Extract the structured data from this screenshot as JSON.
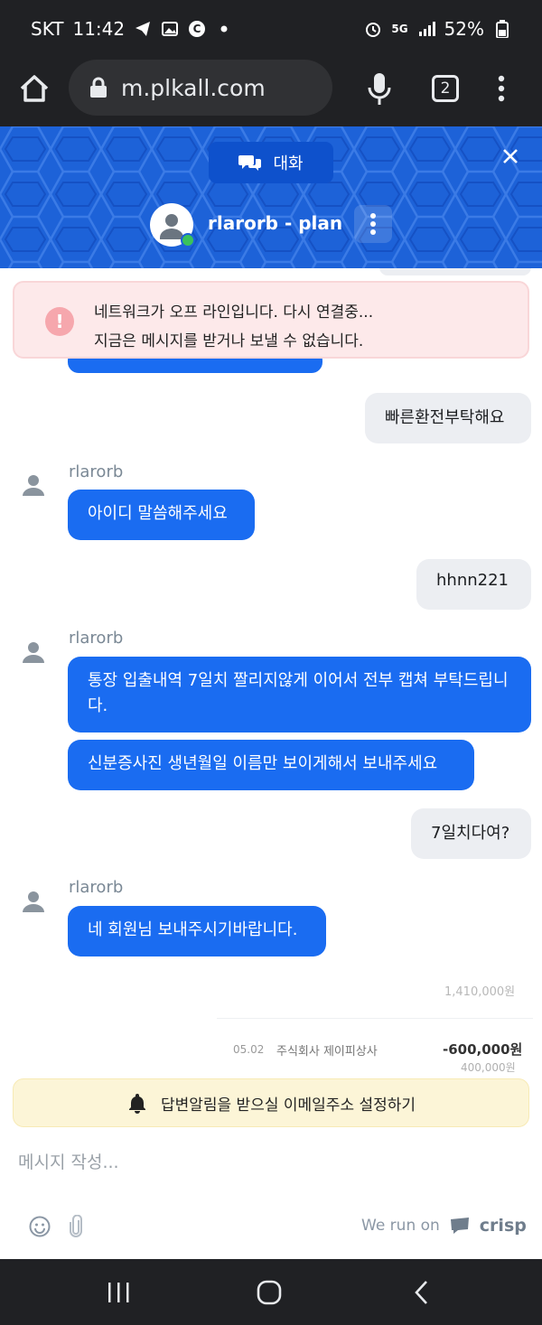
{
  "status_bar": {
    "carrier": "SKT",
    "time": "11:42",
    "network": "5G",
    "battery": "52%"
  },
  "browser": {
    "url": "m.plkall.com",
    "tab_count": "2"
  },
  "chat_header": {
    "conversation_label": "대화",
    "agent_name": "rlarorb - plan",
    "brand_color": "#1d62d8"
  },
  "offline_banner": {
    "line1": "네트워크가 오프 라인입니다. 다시 연결중...",
    "line2": "지금은 메시지를 받거나 보낼 수 없습니다."
  },
  "messages": [
    {
      "from": "user",
      "text": "빠른환전부탁해요"
    },
    {
      "from": "agent",
      "author": "rlarorb",
      "text": "아이디 말씀해주세요"
    },
    {
      "from": "user",
      "text": "hhnn221"
    },
    {
      "from": "agent",
      "author": "rlarorb",
      "text": "통장 입출내역 7일치 짤리지않게 이어서 전부 캡쳐 부탁드립니다."
    },
    {
      "from": "agent",
      "author": "rlarorb",
      "text": "신분증사진 생년월일 이름만 보이게해서 보내주세요"
    },
    {
      "from": "user",
      "text": "7일치다여?"
    },
    {
      "from": "agent",
      "author": "rlarorb",
      "text": "네 회원님 보내주시기바랍니다."
    }
  ],
  "background_receipt": {
    "row1_amount": "1,410,000원",
    "row2_date": "05.02",
    "row2_merchant": "주식회사 제이피상사",
    "row2_amount": "-600,000원",
    "row2_balance": "400,000원"
  },
  "email_prompt": {
    "text": "답변알림을 받으실 이메일주소 설정하기"
  },
  "composer": {
    "placeholder": "메시지 작성...",
    "powered_by": "We run on",
    "brand": "crisp"
  }
}
